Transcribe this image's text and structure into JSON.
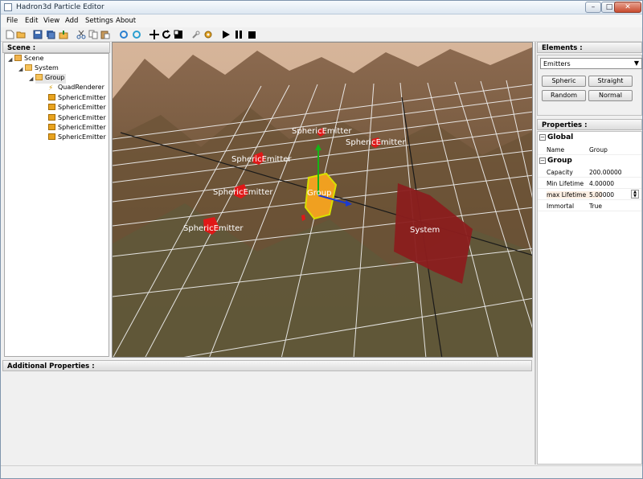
{
  "window": {
    "title": "Hadron3d Particle Editor",
    "controls": [
      "–",
      "□",
      "✕"
    ]
  },
  "menu": [
    "File",
    "Edit",
    "View",
    "Add",
    "Settings",
    "About"
  ],
  "scene": {
    "header": "Scene :",
    "tree": [
      {
        "label": "Scene",
        "icon": "scene-icon"
      },
      {
        "label": "System",
        "icon": "folder-icon"
      },
      {
        "label": "Group",
        "icon": "folder-icon"
      },
      {
        "label": "QuadRenderer",
        "icon": "renderer-icon"
      },
      {
        "label": "SphericEmitter",
        "icon": "emitter-icon"
      },
      {
        "label": "SphericEmitter",
        "icon": "emitter-icon"
      },
      {
        "label": "SphericEmitter",
        "icon": "emitter-icon"
      },
      {
        "label": "SphericEmitter",
        "icon": "emitter-icon"
      },
      {
        "label": "SphericEmitter",
        "icon": "emitter-icon"
      }
    ]
  },
  "viewport": {
    "labels": {
      "emitter1": "SphericEmitter",
      "emitter2": "SphericEmitter",
      "emitter3": "SphericEmitter",
      "emitter4": "SphericEmitter",
      "emitter5": "SphericEmitter",
      "group": "Group",
      "system": "System"
    }
  },
  "additional": {
    "header": "Additional Properties :"
  },
  "elements": {
    "header": "Elements :",
    "selected": "Emitters",
    "buttons": [
      "Spheric",
      "Straight",
      "Random",
      "Normal"
    ]
  },
  "properties": {
    "header": "Properties :",
    "global": {
      "title": "Global",
      "rows": [
        {
          "key": "Name",
          "value": "Group"
        }
      ]
    },
    "group": {
      "title": "Group",
      "rows": [
        {
          "key": "Capacity",
          "value": "200.00000"
        },
        {
          "key": "Min Lifetime",
          "value": "4.00000"
        },
        {
          "key": "max Lifetime",
          "value": "5.00000"
        },
        {
          "key": "Immortal",
          "value": "True"
        }
      ]
    }
  },
  "colors": {
    "selection": "#ffeedd",
    "emitter": "#d81e1e",
    "system": "#8b1e1e"
  }
}
